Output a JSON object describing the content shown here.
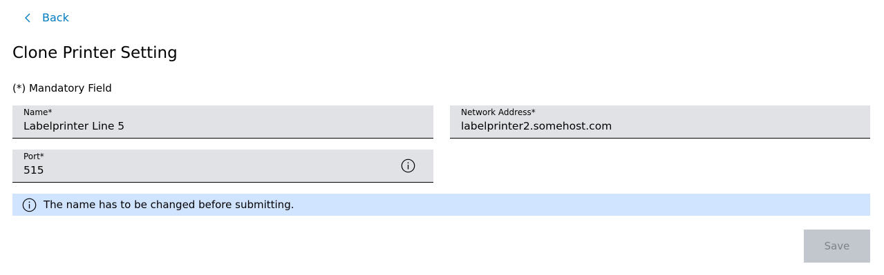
{
  "nav": {
    "back_label": "Back"
  },
  "page": {
    "title": "Clone Printer Setting",
    "mandatory_note": "(*) Mandatory Field"
  },
  "form": {
    "name": {
      "label": "Name*",
      "value": "Labelprinter Line 5"
    },
    "network_address": {
      "label": "Network Address*",
      "value": "labelprinter2.somehost.com"
    },
    "port": {
      "label": "Port*",
      "value": "515"
    }
  },
  "notice": {
    "text": "The name has to be changed before submitting.",
    "icon": "info-icon"
  },
  "actions": {
    "save_label": "Save",
    "save_enabled": false
  },
  "colors": {
    "link": "#007bc0",
    "field_bg": "#e0e2e5",
    "notice_bg": "#d1e4ff",
    "button_disabled_bg": "#c1c7cc",
    "button_disabled_text": "#7d8389"
  }
}
